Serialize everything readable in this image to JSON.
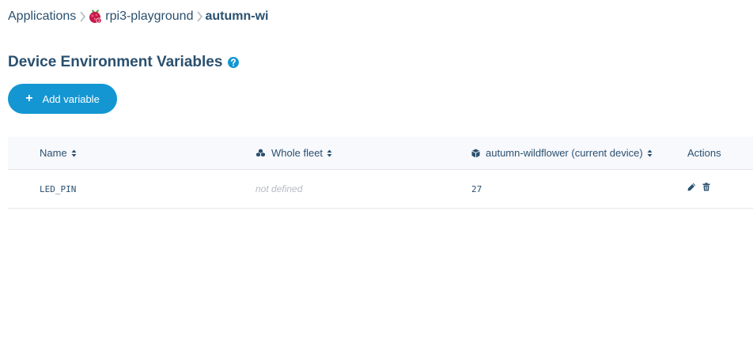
{
  "breadcrumb": {
    "applications": "Applications",
    "app": "rpi3-playground",
    "device": "autumn-wi"
  },
  "page": {
    "title": "Device Environment Variables"
  },
  "toolbar": {
    "add_label": "Add variable"
  },
  "table": {
    "columns": {
      "name": "Name",
      "fleet": "Whole fleet",
      "device": "autumn-wildflower (current device)",
      "actions": "Actions"
    },
    "rows": [
      {
        "name": "LED_PIN",
        "fleet": "not defined",
        "device": "27"
      }
    ]
  },
  "colors": {
    "accent": "#1496d2",
    "text": "#2a506f",
    "muted": "#b5bcc4",
    "header_bg": "#f8f9fd"
  },
  "icons": [
    "raspberry-pi-icon",
    "help-icon",
    "plus-icon",
    "sort-icon",
    "fleet-icon",
    "device-cube-icon",
    "pencil-icon",
    "trash-icon"
  ]
}
